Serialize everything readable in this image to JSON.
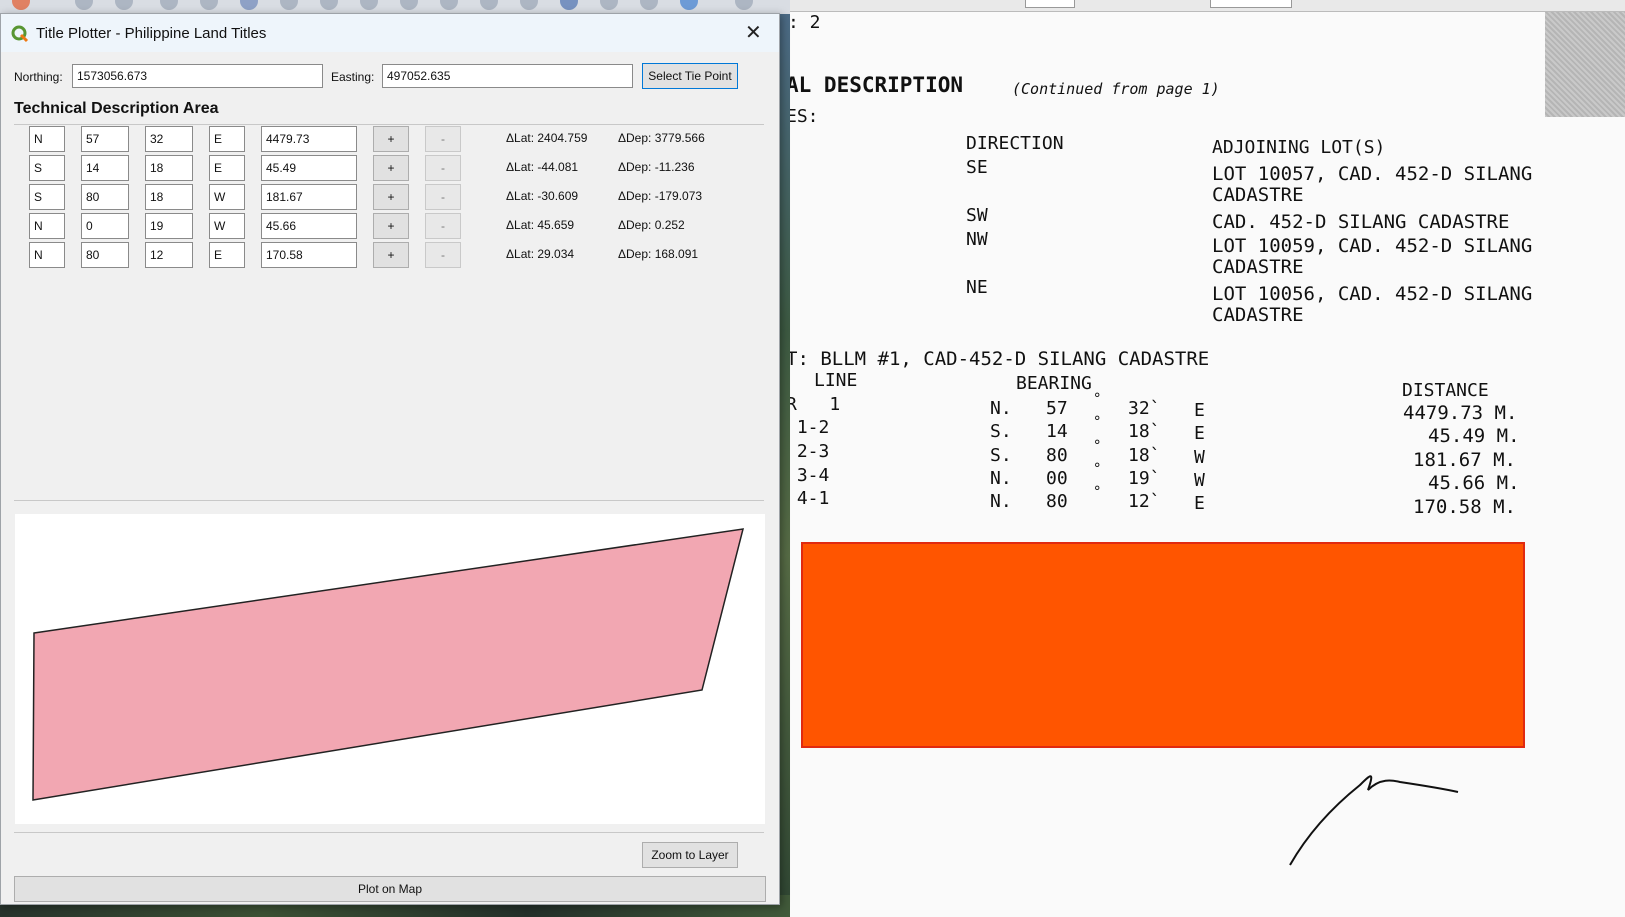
{
  "dialog": {
    "title": "Title Plotter - Philippine Land Titles",
    "close_glyph": "✕",
    "northing_label": "Northing:",
    "northing_value": "1573056.673",
    "easting_label": "Easting:",
    "easting_value": "497052.635",
    "select_tie_point": "Select Tie Point",
    "section_title": "Technical Description Area",
    "plus_label": "+",
    "minus_label": "-",
    "rows": [
      {
        "ns": "N",
        "deg": "57",
        "min": "32",
        "ew": "E",
        "dist": "4479.73",
        "dlat": "ΔLat: 2404.759",
        "ddep": "ΔDep: 3779.566"
      },
      {
        "ns": "S",
        "deg": "14",
        "min": "18",
        "ew": "E",
        "dist": "45.49",
        "dlat": "ΔLat: -44.081",
        "ddep": "ΔDep: -11.236"
      },
      {
        "ns": "S",
        "deg": "80",
        "min": "18",
        "ew": "W",
        "dist": "181.67",
        "dlat": "ΔLat: -30.609",
        "ddep": "ΔDep: -179.073"
      },
      {
        "ns": "N",
        "deg": "0",
        "min": "19",
        "ew": "W",
        "dist": "45.66",
        "dlat": "ΔLat: 45.659",
        "ddep": "ΔDep: 0.252"
      },
      {
        "ns": "N",
        "deg": "80",
        "min": "12",
        "ew": "E",
        "dist": "170.58",
        "dlat": "ΔLat: 29.034",
        "ddep": "ΔDep: 168.091"
      }
    ],
    "zoom_to_layer": "Zoom to Layer",
    "plot_on_map": "Plot on Map",
    "polygon_fill": "#f2a7b2",
    "polygon_stroke": "#222222"
  },
  "document": {
    "page_fragment": ": 2",
    "heading": "AL DESCRIPTION",
    "heading_note": "(Continued from page 1)",
    "es_label": "ES:",
    "direction_header": "DIRECTION",
    "adjoining_header": "ADJOINING LOT(S)",
    "adjoining": [
      {
        "dir": "SE",
        "lot": "LOT 10057, CAD. 452-D SILANG",
        "lot2": "CADASTRE"
      },
      {
        "dir": "SW",
        "lot": "CAD. 452-D SILANG CADASTRE",
        "lot2": ""
      },
      {
        "dir": "NW",
        "lot": "LOT 10059, CAD. 452-D SILANG",
        "lot2": "CADASTRE"
      },
      {
        "dir": "NE",
        "lot": "LOT 10056, CAD. 452-D SILANG",
        "lot2": "CADASTRE"
      }
    ],
    "tie_line": "T: BLLM #1, CAD-452-D SILANG CADASTRE",
    "line_header": "LINE",
    "bearing_header": "BEARING",
    "distance_header": "DISTANCE",
    "bearings": [
      {
        "line": "R   1",
        "ns": "N.",
        "deg": "57",
        "min": "32`",
        "ew": "E",
        "dist": "4479.73 M."
      },
      {
        "line": " 1-2",
        "ns": "S.",
        "deg": "14",
        "min": "18`",
        "ew": "E",
        "dist": "45.49 M."
      },
      {
        "line": " 2-3",
        "ns": "S.",
        "deg": "80",
        "min": "18`",
        "ew": "W",
        "dist": "181.67 M."
      },
      {
        "line": " 3-4",
        "ns": "N.",
        "deg": "00",
        "min": "19`",
        "ew": "W",
        "dist": "45.66 M."
      },
      {
        "line": " 4-1",
        "ns": "N.",
        "deg": "80",
        "min": "12`",
        "ew": "E",
        "dist": "170.58 M."
      }
    ],
    "degree_glyph": "°",
    "redaction_color": "#ff5500"
  }
}
